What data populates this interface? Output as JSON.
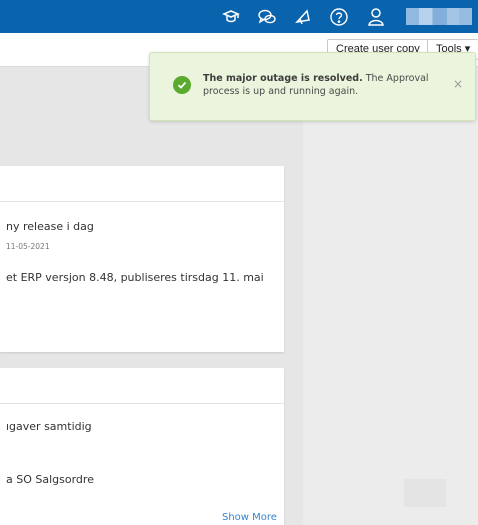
{
  "topbar": {
    "icons": [
      "graduation-cap-icon",
      "chat-bubbles-icon",
      "megaphone-icon",
      "help-icon",
      "user-icon"
    ]
  },
  "toolbar": {
    "create_user_copy_label": "Create user copy",
    "tools_label": "Tools ▾"
  },
  "toast": {
    "title": "The major outage is resolved.",
    "message": "The Approval process is up and running again.",
    "close": "×",
    "color": "#5aaa2e"
  },
  "cards": [
    {
      "title": "ny release i dag",
      "date": "11-05-2021",
      "body": "et ERP versjon 8.48, publiseres tirsdag 11. mai"
    },
    {
      "title": "ıgaver samtidig",
      "body": "a SO Salgsordre"
    }
  ],
  "footer_link": "Show More",
  "colors": {
    "topbar": "#0a63ad",
    "link": "#3a84c9"
  }
}
